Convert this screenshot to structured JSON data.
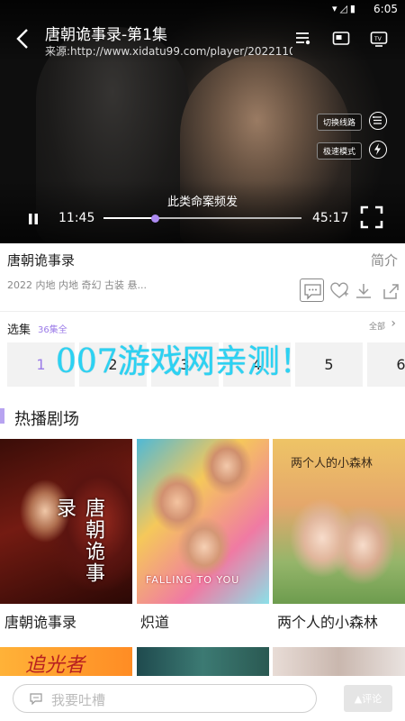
{
  "status_bar": {
    "time": "6:05",
    "icons": [
      "wifi-icon",
      "signal-icon",
      "battery-icon"
    ]
  },
  "player": {
    "title": "唐朝诡事录-第1集",
    "source": "来源:http://www.xidatu99.com/player/2022110...",
    "switch_line_label": "切换线路",
    "speed_mode_label": "极速模式",
    "subtitle": "此类命案频发",
    "current_time": "11:45",
    "duration": "45:17",
    "progress_fraction": 0.26
  },
  "info": {
    "title": "唐朝诡事录",
    "intro_link": "简介",
    "meta": "2022 内地 内地 奇幻 古装 悬..."
  },
  "episodes": {
    "label": "选集",
    "count": "36集全",
    "all_label": "全部",
    "items": [
      "1",
      "2",
      "3",
      "4",
      "5",
      "6"
    ]
  },
  "watermark": "007游戏网亲测！",
  "hot": {
    "title": "热播剧场",
    "cards": [
      {
        "label": "唐朝诡事录",
        "poster_text": "唐朝诡事录"
      },
      {
        "label": "炽道",
        "poster_text": "FALLING TO YOU"
      },
      {
        "label": "两个人的小森林",
        "poster_text": "两个人的小森林"
      }
    ],
    "row2_first_text": "追光者"
  },
  "bottom": {
    "placeholder": "我要吐槽",
    "comment_button": "▲评论"
  },
  "colors": {
    "accent": "#9b7be8",
    "watermark": "#2bd2f3",
    "section_bar": "#b7a3f0"
  }
}
